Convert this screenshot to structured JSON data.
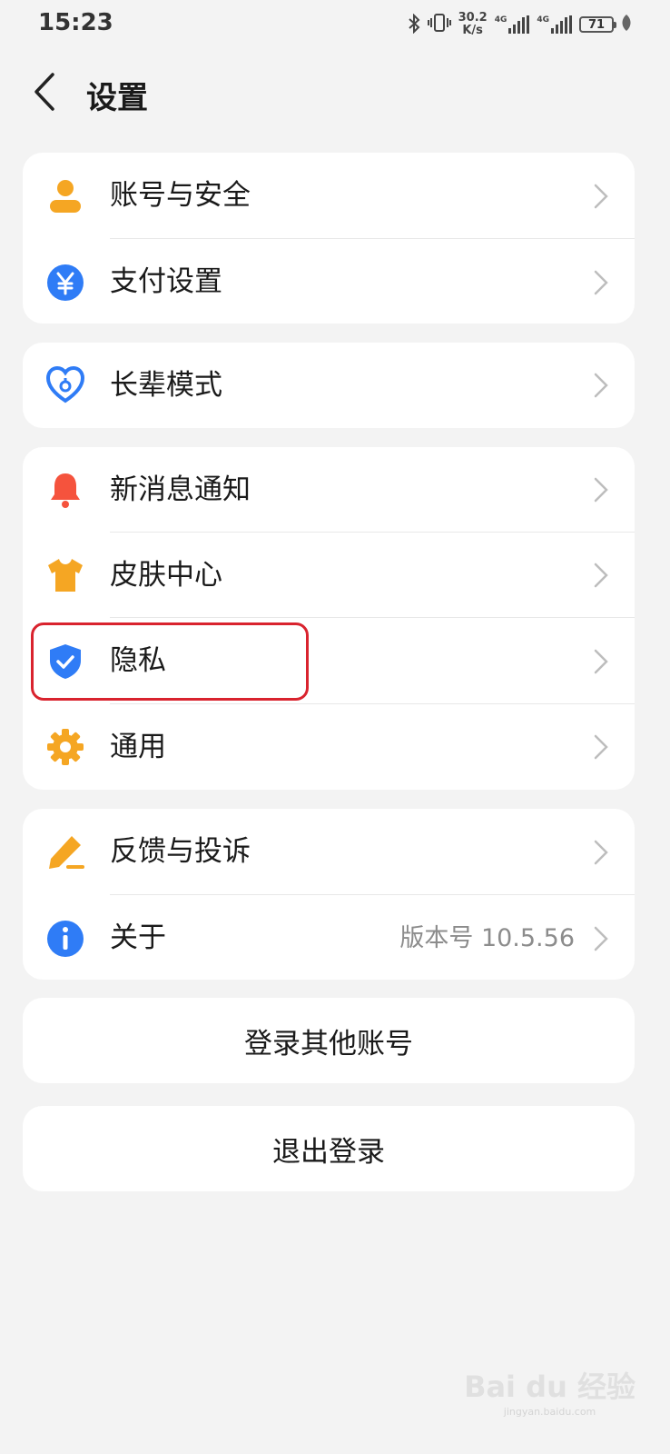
{
  "status_bar": {
    "time": "15:23",
    "speed_value": "30.2",
    "speed_unit": "K/s",
    "net1": "4G",
    "net2": "4G",
    "battery": "71"
  },
  "header": {
    "title": "设置"
  },
  "groups": {
    "account": [
      {
        "label": "账号与安全",
        "icon": "person-icon",
        "color": "#f5a623"
      },
      {
        "label": "支付设置",
        "icon": "yen-icon",
        "color": "#2f7cf6"
      }
    ],
    "elder": [
      {
        "label": "长辈模式",
        "icon": "heart-icon",
        "color": "#2f7cf6"
      }
    ],
    "prefs": [
      {
        "label": "新消息通知",
        "icon": "bell-icon",
        "color": "#f5533d"
      },
      {
        "label": "皮肤中心",
        "icon": "tshirt-icon",
        "color": "#f5a623"
      },
      {
        "label": "隐私",
        "icon": "shield-icon",
        "color": "#2f7cf6"
      },
      {
        "label": "通用",
        "icon": "gear-icon",
        "color": "#f5a623"
      }
    ],
    "support": [
      {
        "label": "反馈与投诉",
        "icon": "pencil-icon",
        "color": "#f5a623"
      },
      {
        "label": "关于",
        "icon": "info-icon",
        "color": "#2f7cf6",
        "value": "版本号 10.5.56"
      }
    ]
  },
  "buttons": {
    "switch_account": "登录其他账号",
    "logout": "退出登录"
  },
  "watermark": {
    "main": "Bai du 经验",
    "sub": "jingyan.baidu.com"
  }
}
